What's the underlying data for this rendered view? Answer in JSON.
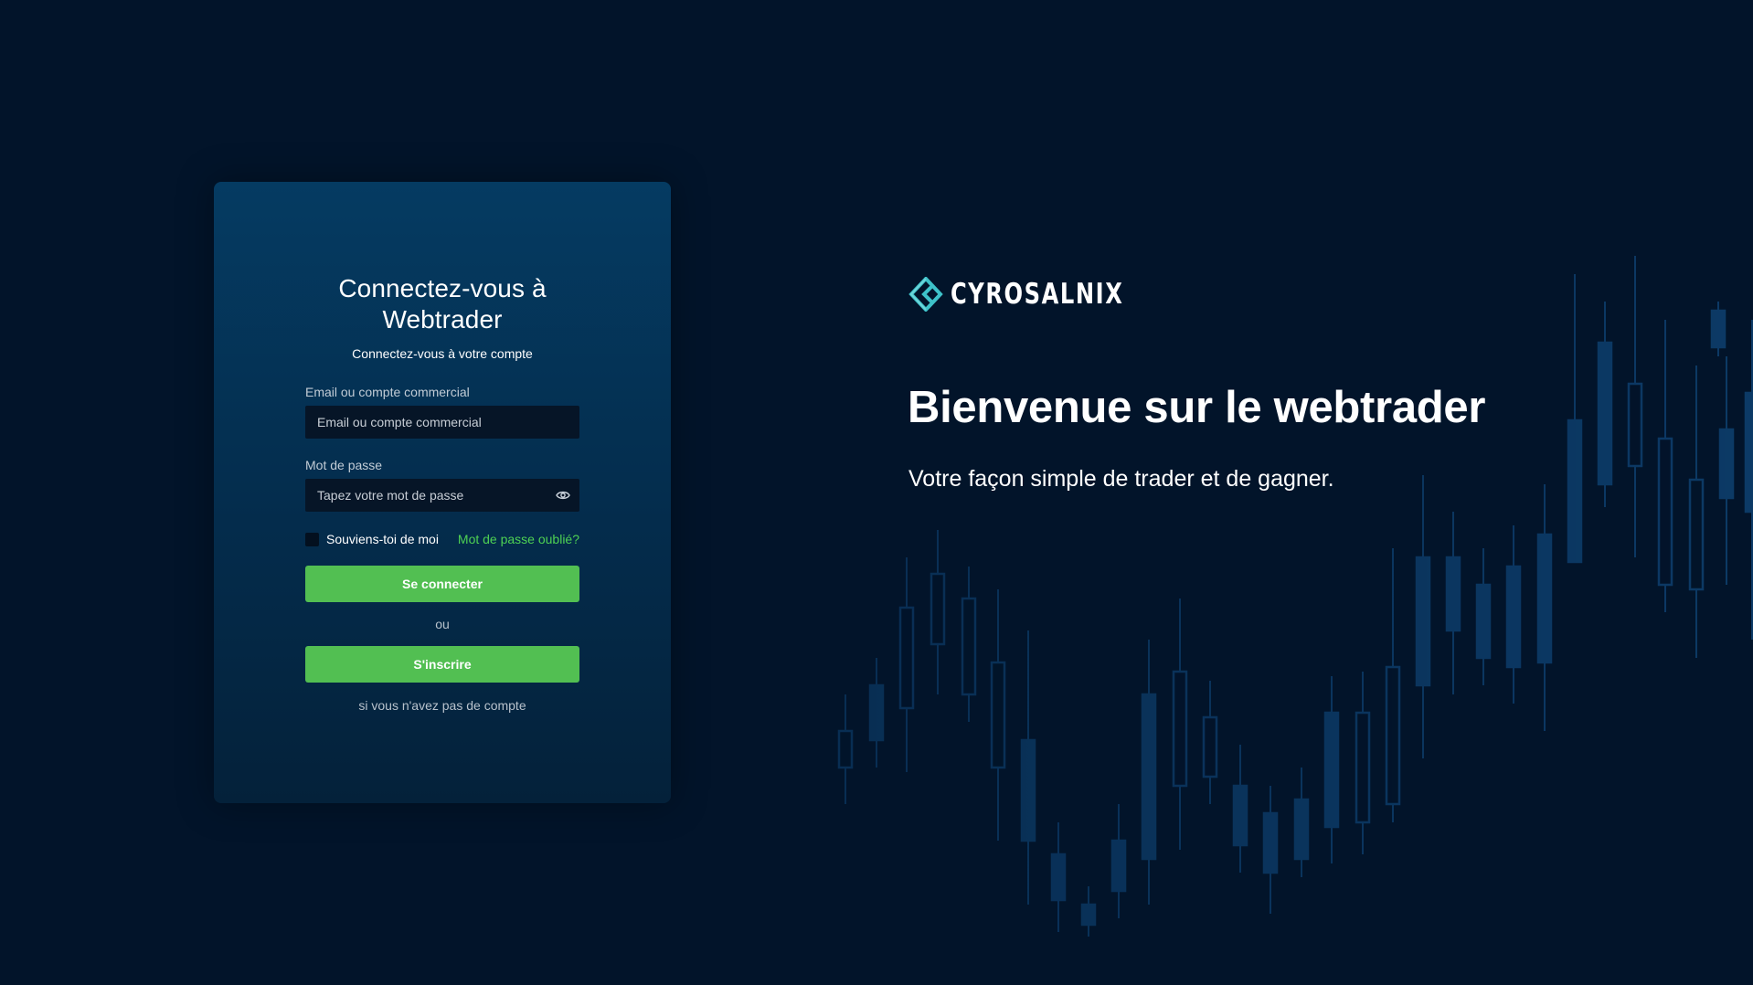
{
  "login": {
    "title": "Connectez-vous à Webtrader",
    "subtitle": "Connectez-vous à votre compte",
    "email_label": "Email ou compte commercial",
    "email_placeholder": "Email ou compte commercial",
    "email_value": "",
    "password_label": "Mot de passe",
    "password_placeholder": "Tapez votre mot de passe",
    "password_value": "",
    "remember_label": "Souviens-toi de moi",
    "remember_checked": false,
    "forgot_link": "Mot de passe oublié?",
    "login_button": "Se connecter",
    "or_text": "ou",
    "register_button": "S'inscrire",
    "no_account_text": "si vous n'avez pas de compte"
  },
  "brand": {
    "name": "CYROSALNIX",
    "logo_icon": "diamond-chevron-logo-icon"
  },
  "hero": {
    "title": "Bienvenue sur le webtrader",
    "subtitle": "Votre façon simple de trader et de gagner."
  },
  "icons": {
    "password_toggle": "eye-icon",
    "background": "candlestick-chart-icon"
  },
  "colors": {
    "page_background": "#02142a",
    "card_top": "#053b62",
    "card_bottom": "#04213a",
    "input_background": "#061527",
    "accent_green": "#52bf52",
    "link_green": "#4ed153",
    "logo_teal": "#3ec2c9",
    "candle_color": "#0c3a66"
  }
}
